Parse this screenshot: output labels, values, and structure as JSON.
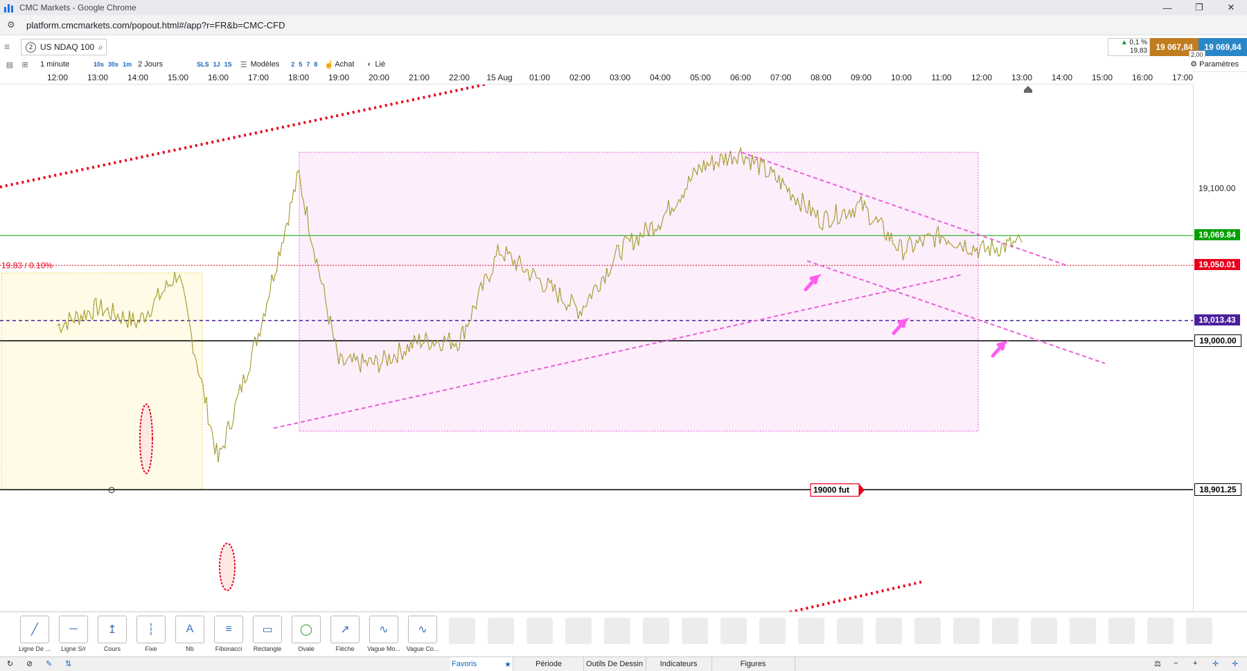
{
  "window": {
    "title": "CMC Markets - Google Chrome",
    "url": "platform.cmcmarkets.com/popout.html#/app?r=FR&b=CMC-CFD"
  },
  "header": {
    "instrument_number": "2",
    "instrument": "US NDAQ 100",
    "change_pct": "0,1 %",
    "change_abs": "19,83",
    "sell_price": "19 067,84",
    "buy_price": "19 069,84",
    "spread": "2,00"
  },
  "toolbar": {
    "interval": "1 minute",
    "q10s": "10s",
    "q30s": "30s",
    "q1m": "1m",
    "range": "2 Jours",
    "sls": "SLS",
    "j1": "1J",
    "s1": "1S",
    "templates": "Modèles",
    "n2": "2",
    "n5": "5",
    "n7": "7",
    "n8": "8",
    "buy": "Achat",
    "linked": "Lié",
    "settings": "Paramètres"
  },
  "time_axis": [
    "12:00",
    "13:00",
    "14:00",
    "15:00",
    "16:00",
    "17:00",
    "18:00",
    "19:00",
    "20:00",
    "21:00",
    "22:00",
    "15 Aug",
    "01:00",
    "02:00",
    "03:00",
    "04:00",
    "05:00",
    "06:00",
    "07:00",
    "08:00",
    "09:00",
    "10:00",
    "11:00",
    "12:00",
    "13:00",
    "14:00",
    "15:00",
    "16:00",
    "17:00"
  ],
  "chart_data": {
    "type": "line",
    "title": "",
    "instrument": "US NDAQ 100",
    "interval": "1 minute",
    "range": "2 Jours",
    "y_tick": "19,100.00",
    "levels": [
      {
        "label": "19,069.84",
        "value": 19069.84,
        "color": "#00a000"
      },
      {
        "label": "19,050.01",
        "value": 19050.01,
        "color": "#e8001c"
      },
      {
        "label": "19,013.43",
        "value": 19013.43,
        "color": "#4b1f9e"
      },
      {
        "label": "19,000.00",
        "value": 19000.0,
        "color": "#000000"
      },
      {
        "label": "18,901.25",
        "value": 18901.25,
        "color": "#000000"
      }
    ],
    "change_label": "19.83 / 0.10%",
    "annotation": "19000 fut",
    "ylim": [
      18820,
      19170
    ],
    "x": [
      "12:00",
      "13:00",
      "14:00",
      "15:00",
      "16:00",
      "17:00",
      "18:00",
      "19:00",
      "20:00",
      "21:00",
      "22:00",
      "15 Aug",
      "01:00",
      "02:00",
      "03:00",
      "04:00",
      "05:00",
      "06:00",
      "07:00",
      "08:00",
      "09:00",
      "10:00",
      "11:00",
      "12:00",
      "13:00"
    ],
    "series": [
      {
        "values": [
          19010,
          19022,
          19012,
          19045,
          18920,
          19005,
          19110,
          18985,
          18985,
          19000,
          19000,
          19060,
          19040,
          19020,
          19060,
          19080,
          19115,
          19125,
          19105,
          19080,
          19090,
          19060,
          19070,
          19060,
          19065
        ]
      }
    ]
  },
  "drawing_tools": [
    "Ligne De ...",
    "Ligne S/r",
    "Cours",
    "Fixe",
    "Nb",
    "Fibonacci",
    "Rectangle",
    "Ovale",
    "Flèche",
    "Vague Mo...",
    "Vague Co..."
  ],
  "bottom_tabs": {
    "favorites": "Favoris",
    "period": "Période",
    "drawing": "Outils De Dessin",
    "indicators": "Indicateurs",
    "figures": "Figures"
  },
  "colors": {
    "sell": "#c07c1e",
    "buy": "#2a87c7",
    "up": "#00a000",
    "down": "#e8001c"
  }
}
